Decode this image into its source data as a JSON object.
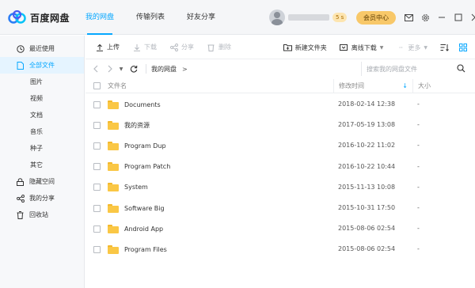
{
  "app": {
    "logo_text": "百度网盘"
  },
  "nav": {
    "tabs": [
      {
        "label": "我的网盘",
        "active": true
      },
      {
        "label": "传输列表",
        "active": false
      },
      {
        "label": "好友分享",
        "active": false
      }
    ]
  },
  "user": {
    "level_badge": "5 s",
    "vip_label": "会员中心"
  },
  "sidebar": {
    "items": [
      {
        "label": "最近使用",
        "icon": "clock-icon"
      },
      {
        "label": "全部文件",
        "icon": "file-icon",
        "active": true
      },
      {
        "label": "图片"
      },
      {
        "label": "视频"
      },
      {
        "label": "文档"
      },
      {
        "label": "音乐"
      },
      {
        "label": "种子"
      },
      {
        "label": "其它"
      },
      {
        "label": "隐藏空间",
        "icon": "lock-icon"
      },
      {
        "label": "我的分享",
        "icon": "share-icon"
      },
      {
        "label": "回收站",
        "icon": "trash-icon"
      }
    ]
  },
  "toolbar": {
    "upload": "上传",
    "download": "下载",
    "share": "分享",
    "delete": "删除",
    "new_folder": "新建文件夹",
    "offline_download": "离线下载",
    "more": "更多"
  },
  "path": {
    "crumb": "我的网盘",
    "separator": ">"
  },
  "search": {
    "placeholder": "搜索我的网盘文件"
  },
  "table": {
    "headers": {
      "name": "文件名",
      "time": "修改时间",
      "size": "大小"
    },
    "rows": [
      {
        "name": "Documents",
        "time": "2018-02-14 12:38",
        "size": "-"
      },
      {
        "name": "我的资源",
        "time": "2017-05-19 13:08",
        "size": "-"
      },
      {
        "name": "Program Dup",
        "time": "2016-10-22 11:02",
        "size": "-"
      },
      {
        "name": "Program Patch",
        "time": "2016-10-22 10:44",
        "size": "-"
      },
      {
        "name": "System",
        "time": "2015-11-13 10:08",
        "size": "-"
      },
      {
        "name": "Software Big",
        "time": "2015-10-31 17:50",
        "size": "-"
      },
      {
        "name": "Android App",
        "time": "2015-08-06 02:54",
        "size": "-"
      },
      {
        "name": "Program Files",
        "time": "2015-08-06 02:54",
        "size": "-"
      }
    ]
  },
  "colors": {
    "accent": "#06a7ff",
    "folder": "#fac745",
    "vip": "#f8c869"
  }
}
